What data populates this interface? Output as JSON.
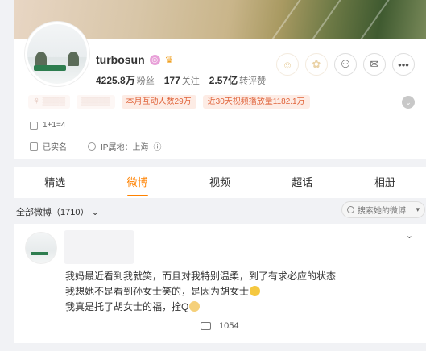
{
  "profile": {
    "name": "turbosun",
    "stats": [
      {
        "num": "4225.8万",
        "label": "粉丝"
      },
      {
        "num": "177",
        "label": "关注"
      },
      {
        "num": "2.57亿",
        "label": "转评赞"
      }
    ],
    "tags": [
      {
        "text": "本月互动人数29万",
        "style": "hot"
      },
      {
        "text": "近30天视频播放量1182.1万",
        "style": "hot"
      }
    ],
    "bio": "1+1=4",
    "verified": "已实名",
    "ip_location": "IP属地：上海"
  },
  "tabs": [
    {
      "label": "精选"
    },
    {
      "label": "微博"
    },
    {
      "label": "视频"
    },
    {
      "label": "超话"
    },
    {
      "label": "相册"
    }
  ],
  "filter": {
    "all_label": "全部微博（1710）",
    "search_placeholder": "搜索她的微博"
  },
  "post": {
    "lines": [
      "我妈最近看到我就笑，而且对我特别温柔，到了有求必应的状态",
      "我想她不是看到孙女士笑的，是因为胡女士",
      "我真是托了胡女士的福，拴Q"
    ],
    "comments": "1054"
  },
  "colors": {
    "accent": "#ff8200",
    "hot_tag": "#e0633a"
  }
}
